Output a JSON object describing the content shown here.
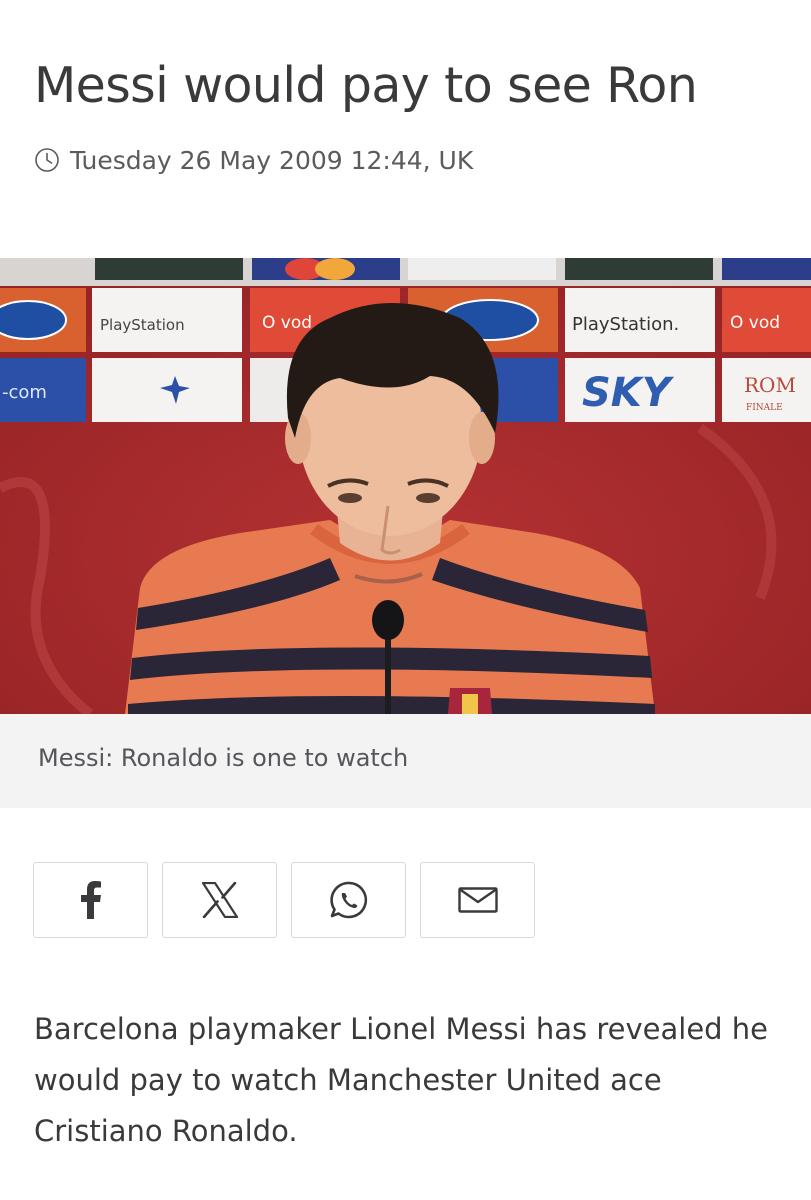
{
  "article": {
    "headline": "Messi would pay to see Ron",
    "timestamp": "Tuesday 26 May 2009 12:44, UK",
    "image": {
      "caption": "Messi: Ronaldo is one to watch",
      "backdrop_logos": [
        "Ford",
        "PlayStation",
        "vodafone",
        "SKY",
        "ROMA FINALE",
        ".com"
      ],
      "colors": {
        "backdrop": "#a92a2b",
        "shirt_orange": "#e87a52",
        "shirt_stripe": "#2a2638"
      }
    },
    "share": [
      {
        "name": "facebook",
        "icon": "facebook-icon"
      },
      {
        "name": "x",
        "icon": "x-icon"
      },
      {
        "name": "whatsapp",
        "icon": "whatsapp-icon"
      },
      {
        "name": "email",
        "icon": "email-icon"
      }
    ],
    "body": "Barcelona playmaker Lionel Messi has revealed he would pay to watch Manchester United ace Cristiano Ronaldo."
  },
  "colors": {
    "text": "#3a3a3d",
    "caption_bg": "#f3f3f4",
    "button_border": "#d9d9dc"
  }
}
